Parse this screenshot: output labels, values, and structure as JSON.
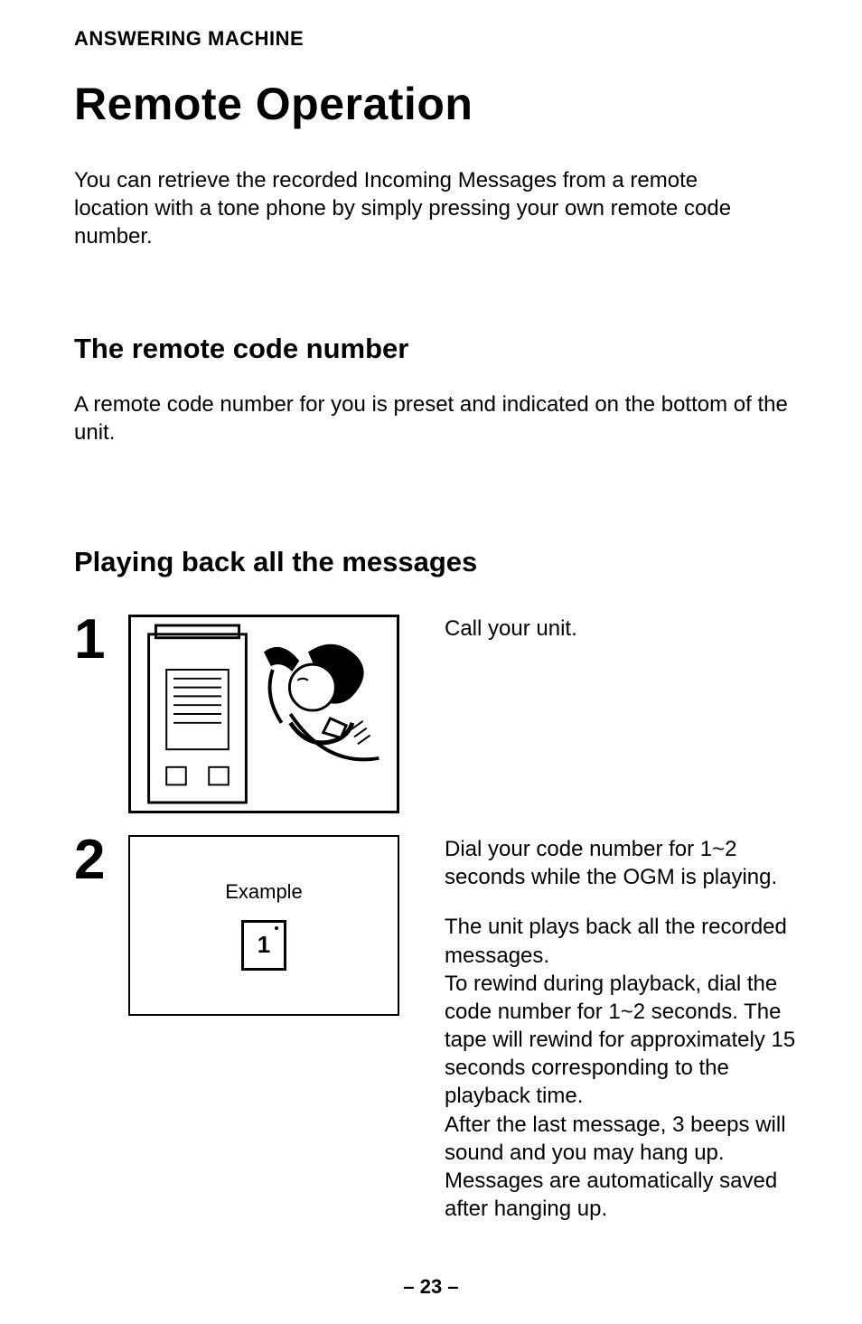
{
  "section_label": "ANSWERING MACHINE",
  "title": "Remote Operation",
  "intro": "You can retrieve the recorded Incoming Messages from a remote location with a tone phone by simply pressing your own remote code number.",
  "h2_a": "The remote code number",
  "para_a": "A remote code number for you is preset and indicated on the bottom of the unit.",
  "h2_b": "Playing back all the messages",
  "steps": {
    "s1": {
      "num": "1",
      "text": "Call your unit."
    },
    "s2": {
      "num": "2",
      "example_label": "Example",
      "key": "1",
      "p1": "Dial your code number for 1~2 seconds while the OGM is playing.",
      "p2": "The unit plays back all the recorded messages.\nTo rewind during playback, dial the code number for 1~2 seconds. The tape will rewind for approximately 15 seconds corresponding to the playback time.\nAfter the last message, 3 beeps will sound and you may hang up. Messages are automatically saved after hanging up."
    }
  },
  "page_number": "– 23 –"
}
